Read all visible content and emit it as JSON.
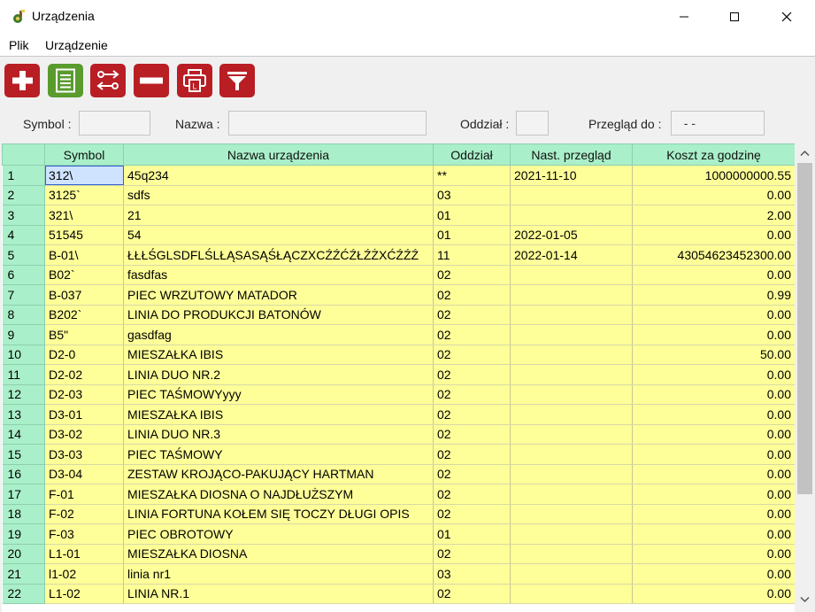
{
  "window": {
    "title": "Urządzenia"
  },
  "menu": {
    "items": [
      "Plik",
      "Urządzenie"
    ]
  },
  "toolbar": {
    "buttons": [
      {
        "icon": "plus-icon",
        "color": "#b81e24"
      },
      {
        "icon": "document-list-icon",
        "color": "#5a9b2e"
      },
      {
        "icon": "edit-swap-icon",
        "color": "#b81e24"
      },
      {
        "icon": "minus-icon",
        "color": "#b81e24"
      },
      {
        "icon": "printer-icon",
        "color": "#b81e24"
      },
      {
        "icon": "filter-icon",
        "color": "#b81e24"
      }
    ]
  },
  "filters": {
    "symbol_label": "Symbol :",
    "symbol_value": "",
    "nazwa_label": "Nazwa :",
    "nazwa_value": "",
    "oddzial_label": "Oddział :",
    "oddzial_value": "",
    "przeglad_label": "Przegląd do :",
    "przeglad_value": "  - -"
  },
  "table": {
    "columns": [
      "",
      "Symbol",
      "Nazwa urządzenia",
      "Oddział",
      "Nast. przegląd",
      "Koszt za godzinę"
    ],
    "rows": [
      [
        "1",
        "312\\",
        "45q234",
        "**",
        "2021-11-10",
        "1000000000.55"
      ],
      [
        "2",
        "3125`",
        "sdfs",
        "03",
        "",
        "0.00"
      ],
      [
        "3",
        "321\\",
        "21",
        "01",
        "",
        "2.00"
      ],
      [
        "4",
        "51545",
        "54",
        "01",
        "2022-01-05",
        "0.00"
      ],
      [
        "5",
        "B-01\\",
        "ŁŁŁŚGLSDFLŚLŁĄSASĄŚŁĄCZXCŹŹĆŹŁŹŻXĆŹŹŹ",
        "11",
        "2022-01-14",
        "43054623452300.00"
      ],
      [
        "6",
        "B02`",
        "fasdfas",
        "02",
        "",
        "0.00"
      ],
      [
        "7",
        "B-037",
        "PIEC WRZUTOWY MATADOR",
        "02",
        "",
        "0.99"
      ],
      [
        "8",
        "B202`",
        "LINIA DO PRODUKCJI BATONÓW",
        "02",
        "",
        "0.00"
      ],
      [
        "9",
        "B5\"",
        "gasdfag",
        "02",
        "",
        "0.00"
      ],
      [
        "10",
        "D2-0",
        "MIESZAŁKA IBIS",
        "02",
        "",
        "50.00"
      ],
      [
        "11",
        "D2-02",
        "LINIA DUO NR.2",
        "02",
        "",
        "0.00"
      ],
      [
        "12",
        "D2-03",
        "PIEC TAŚMOWYyyy",
        "02",
        "",
        "0.00"
      ],
      [
        "13",
        "D3-01",
        "MIESZAŁKA  IBIS",
        "02",
        "",
        "0.00"
      ],
      [
        "14",
        "D3-02",
        "LINIA DUO NR.3",
        "02",
        "",
        "0.00"
      ],
      [
        "15",
        "D3-03",
        "PIEC  TAŚMOWY",
        "02",
        "",
        "0.00"
      ],
      [
        "16",
        "D3-04",
        "ZESTAW  KROJĄCO-PAKUJĄCY HARTMAN",
        "02",
        "",
        "0.00"
      ],
      [
        "17",
        "F-01",
        "MIESZAŁKA DIOSNA O NAJDŁUŻSZYM",
        "02",
        "",
        "0.00"
      ],
      [
        "18",
        "F-02",
        "LINIA FORTUNA KOŁEM SIĘ TOCZY DŁUGI OPIS",
        "02",
        "",
        "0.00"
      ],
      [
        "19",
        "F-03",
        "PIEC  OBROTOWY",
        "01",
        "",
        "0.00"
      ],
      [
        "20",
        "L1-01",
        "MIESZAŁKA DIOSNA",
        "02",
        "",
        "0.00"
      ],
      [
        "21",
        "l1-02",
        "linia nr1",
        "03",
        "",
        "0.00"
      ],
      [
        "22",
        "L1-02",
        "LINIA  NR.1",
        "02",
        "",
        "0.00"
      ]
    ]
  },
  "colors": {
    "header_bg": "#a9efc9",
    "row_bg": "#ffff99",
    "selection": "#cfe3ff"
  }
}
